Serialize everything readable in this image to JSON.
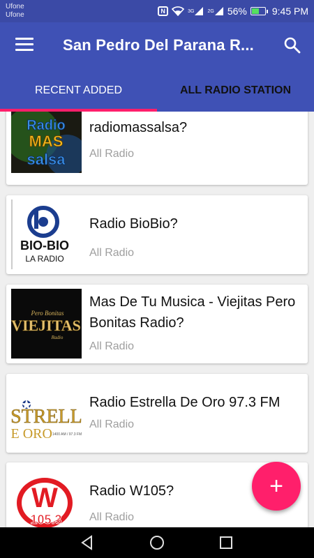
{
  "status_bar": {
    "carrier_1": "Ufone",
    "carrier_2": "Ufone",
    "nfc": "N",
    "net_3g": "3G",
    "net_2g": "2G",
    "battery_text": "56%",
    "battery_level": 0.56,
    "time": "9:45 PM"
  },
  "app_bar": {
    "title": "San Pedro Del Parana R..."
  },
  "tabs": [
    {
      "label": "RECENT ADDED",
      "active": true
    },
    {
      "label": "ALL RADIO STATION",
      "active": false
    }
  ],
  "stations": [
    {
      "title": "radiomassalsa?",
      "subtitle": "All Radio",
      "logo": "radio-mas-salsa-logo"
    },
    {
      "title": "Radio BioBio?",
      "subtitle": "All Radio",
      "logo": "bio-bio-la-radio-logo",
      "logo_text_1": "BIO-BIO",
      "logo_text_2": "LA RADIO"
    },
    {
      "title": "Mas De Tu Musica - Viejitas Pero Bonitas Radio?",
      "subtitle": "All Radio",
      "logo": "viejitas-logo"
    },
    {
      "title": "Radio Estrella De Oro 97.3 FM",
      "subtitle": "All Radio",
      "logo": "estrella-de-oro-logo"
    },
    {
      "title": "Radio W105?",
      "subtitle": "All Radio",
      "logo": "w105-logo"
    }
  ],
  "fab": {
    "label": "+"
  },
  "colors": {
    "primary": "#3f51b5",
    "status_bar": "#3b4aa6",
    "accent": "#ff1f6b"
  }
}
